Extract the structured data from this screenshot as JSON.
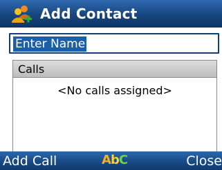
{
  "header": {
    "title": "Add Contact",
    "icon": "contacts-add-icon"
  },
  "name_field": {
    "value": "Enter Name"
  },
  "calls": {
    "header": "Calls",
    "empty_text": "<No calls assigned>"
  },
  "softkeys": {
    "left": "Add Call",
    "right": "Close",
    "input_mode": {
      "a": "A",
      "b": "b",
      "c": "C"
    }
  },
  "colors": {
    "title_bar": "#16457e",
    "selection": "#1b5fa8",
    "panel_header": "#c8c8c8"
  }
}
